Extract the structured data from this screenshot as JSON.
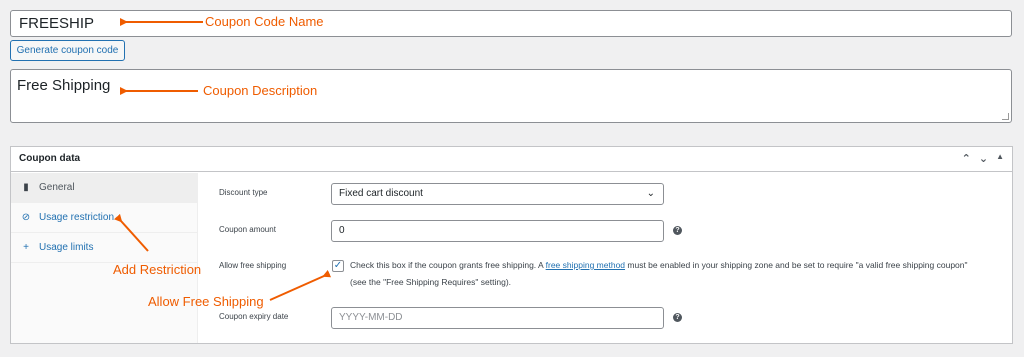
{
  "coupon_code": {
    "value": "FREESHIP",
    "generate_label": "Generate coupon code"
  },
  "description": {
    "value": "Free Shipping"
  },
  "coupon_data": {
    "title": "Coupon data",
    "tabs": [
      {
        "label": "General",
        "icon": "ticket-icon"
      },
      {
        "label": "Usage restriction",
        "icon": "circle-slash-icon"
      },
      {
        "label": "Usage limits",
        "icon": "plus-icon"
      }
    ],
    "discount_type": {
      "label": "Discount type",
      "value": "Fixed cart discount"
    },
    "coupon_amount": {
      "label": "Coupon amount",
      "value": "0"
    },
    "free_shipping": {
      "label": "Allow free shipping",
      "checked": true,
      "text_before": "Check this box if the coupon grants free shipping. A",
      "link_text": "free shipping method",
      "text_after": "must be enabled in your shipping zone and be set to require \"a valid free shipping coupon\" (see the \"Free Shipping Requires\" setting)."
    },
    "expiry": {
      "label": "Coupon expiry date",
      "placeholder": "YYYY-MM-DD"
    }
  },
  "annotations": {
    "code_name": "Coupon Code Name",
    "description": "Coupon Description",
    "restriction": "Add Restriction",
    "free_shipping": "Allow Free Shipping"
  },
  "colors": {
    "annotation": "#ef5c00",
    "link": "#2271b1"
  }
}
